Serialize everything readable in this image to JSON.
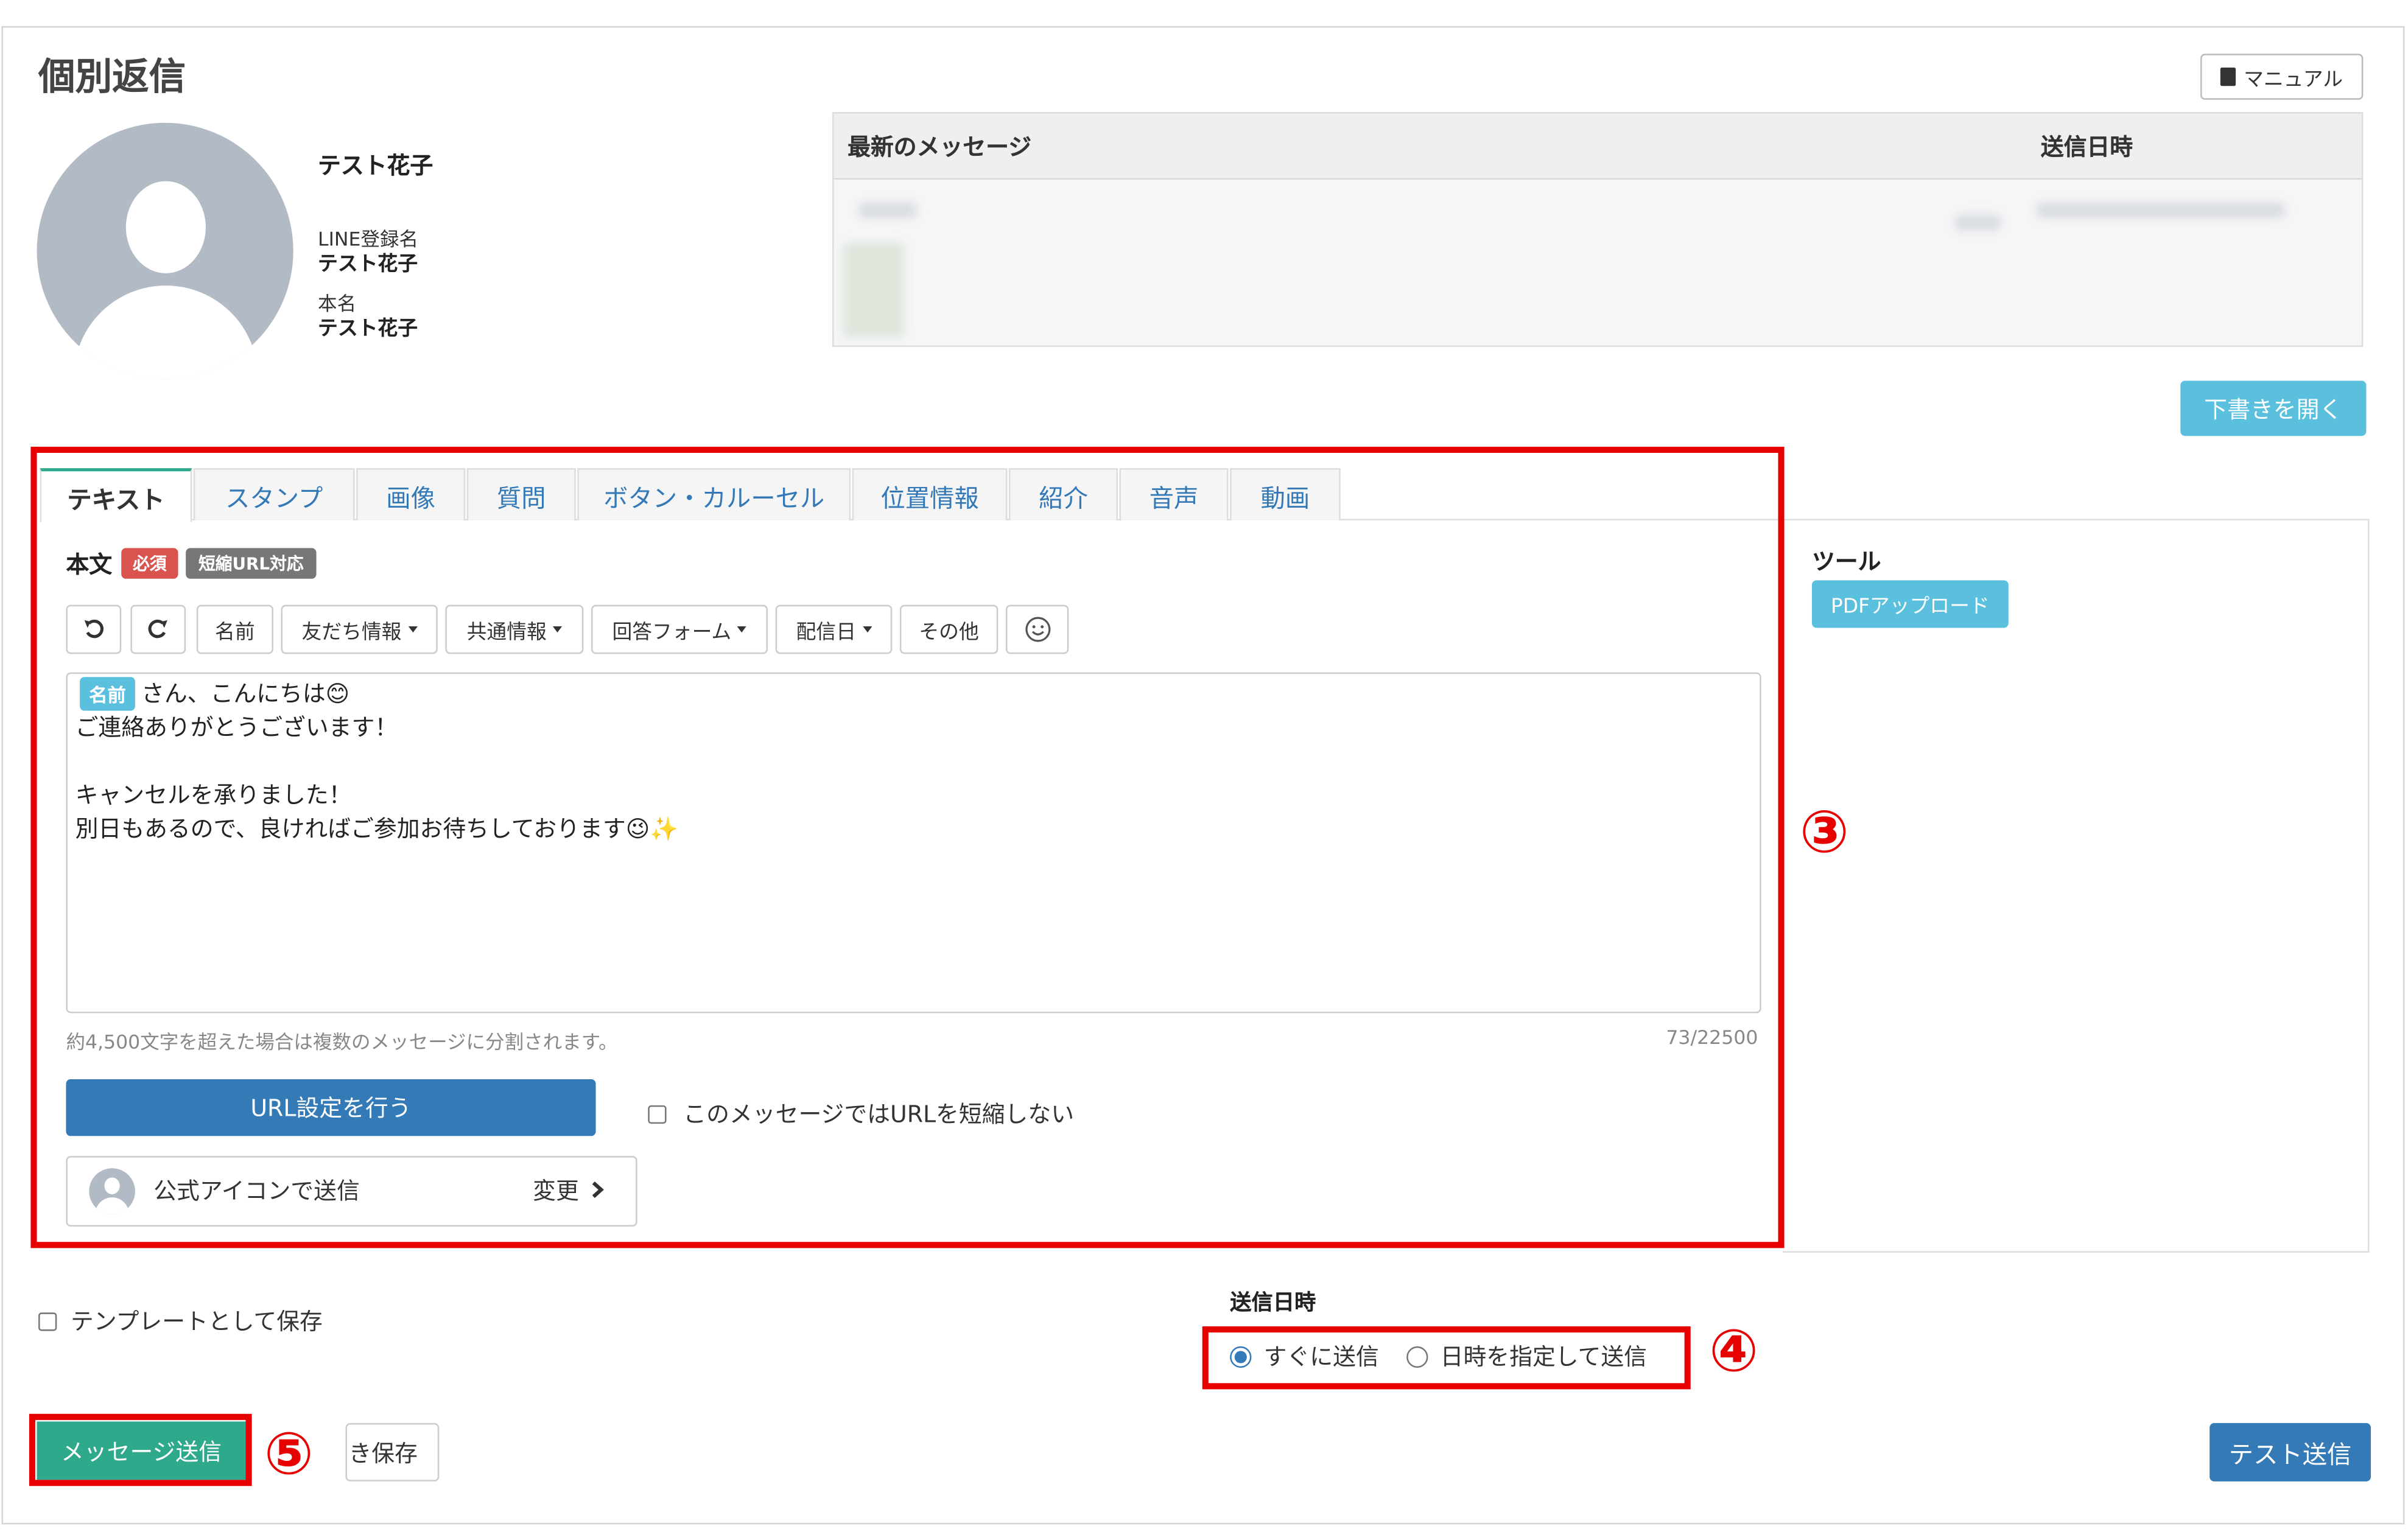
{
  "page": {
    "title": "個別返信",
    "manual_label": "マニュアル"
  },
  "profile": {
    "name": "テスト花子",
    "line_name_label": "LINE登録名",
    "line_name": "テスト花子",
    "real_name_label": "本名",
    "real_name": "テスト花子"
  },
  "messages": {
    "col_message": "最新のメッセージ",
    "col_sent": "送信日時"
  },
  "draft_button": "下書きを開く",
  "tabs": [
    {
      "label": "テキスト",
      "active": true
    },
    {
      "label": "スタンプ"
    },
    {
      "label": "画像"
    },
    {
      "label": "質問"
    },
    {
      "label": "ボタン・カルーセル"
    },
    {
      "label": "位置情報"
    },
    {
      "label": "紹介"
    },
    {
      "label": "音声"
    },
    {
      "label": "動画"
    }
  ],
  "tools": {
    "title": "ツール",
    "pdf_upload": "PDFアップロード"
  },
  "editor": {
    "body_label": "本文",
    "badge_required": "必須",
    "badge_short_url": "短縮URL対応",
    "toolbar": {
      "undo_icon": "undo-icon",
      "redo_icon": "redo-icon",
      "name": "名前",
      "friend_info": "友だち情報",
      "common_info": "共通情報",
      "answer_form": "回答フォーム",
      "delivery_date": "配信日",
      "other": "その他",
      "emoji_icon": "smiley-icon"
    },
    "name_chip": "名前",
    "lines": [
      "さん、こんにちは😊",
      "ご連絡ありがとうございます！",
      "",
      "キャンセルを承りました！",
      "別日もあるので、良ければご参加お待ちしております😉✨"
    ],
    "hint": "約4,500文字を超えた場合は複数のメッセージに分割されます。",
    "count": "73/22500",
    "url_button": "URL設定を行う",
    "no_shorten_label": "このメッセージではURLを短縮しない",
    "sender_label": "公式アイコンで送信",
    "change_label": "変更"
  },
  "footer": {
    "save_template_label": "テンプレートとして保存",
    "send_time_label": "送信日時",
    "send_now_label": "すぐに送信",
    "send_scheduled_label": "日時を指定して送信",
    "send_now_selected": true,
    "send_button": "メッセージ送信",
    "save_draft_button": "き保存",
    "test_send_button": "テスト送信"
  },
  "annotations": {
    "marker3": "③",
    "marker4": "④",
    "marker5": "⑤",
    "highlight_color": "#e60000"
  },
  "colors": {
    "accent_green": "#2fa98c",
    "primary_blue": "#337ab7",
    "info_cyan": "#5bc0de"
  }
}
